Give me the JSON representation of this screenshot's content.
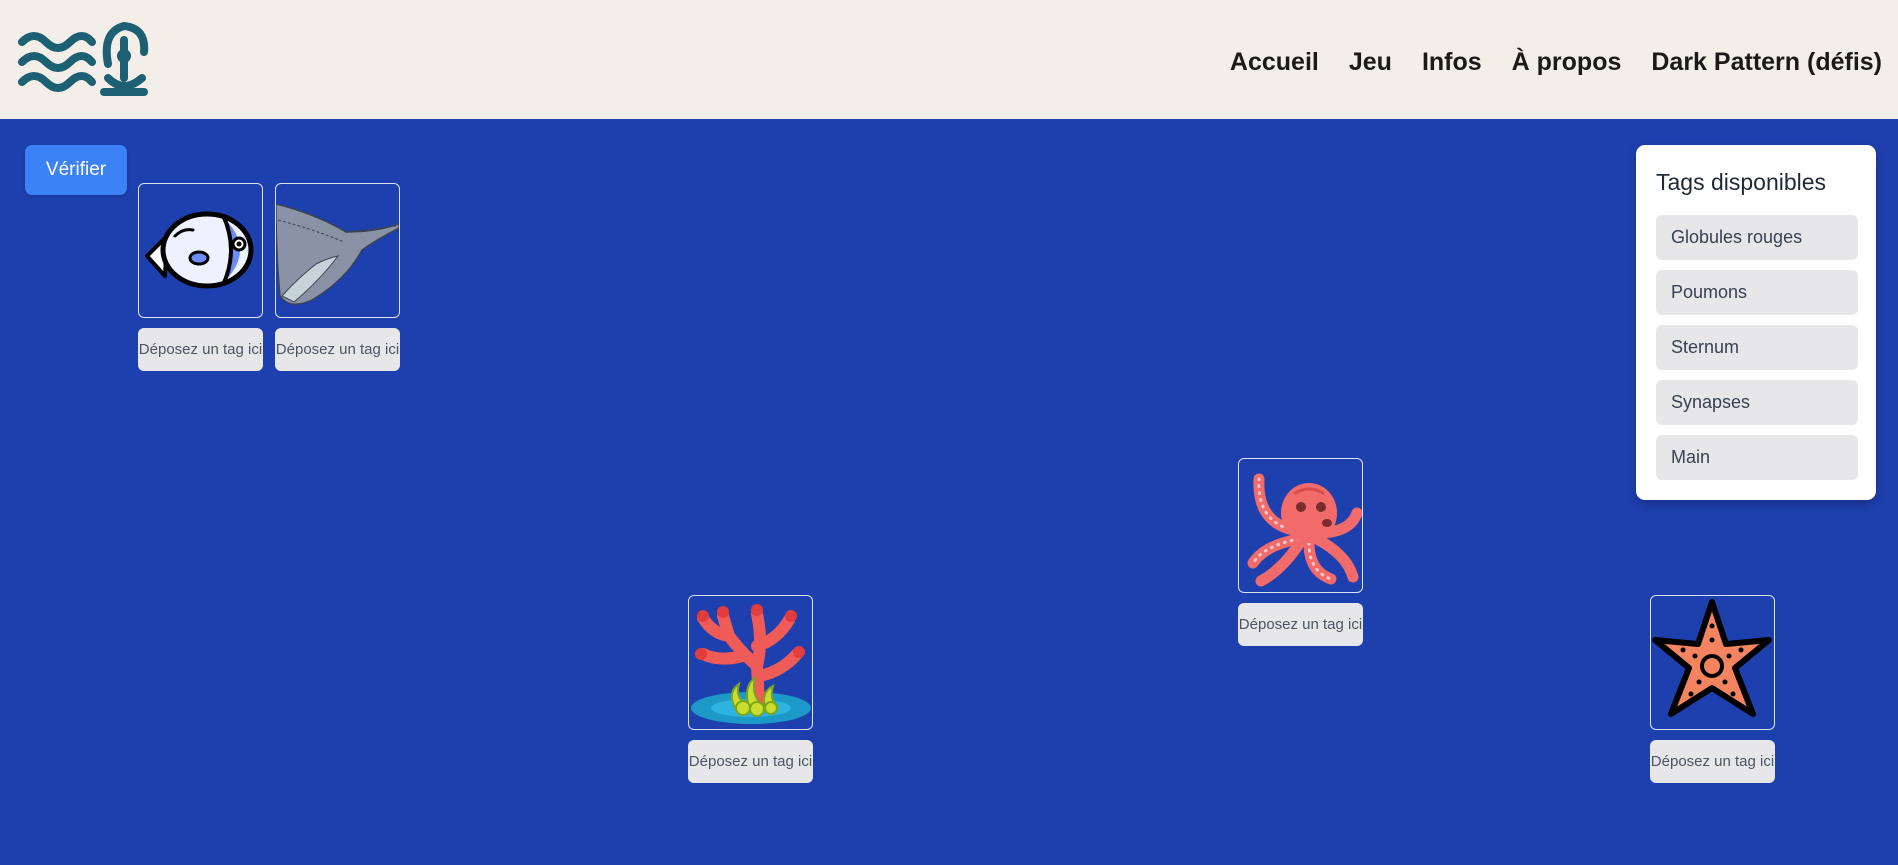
{
  "header": {
    "logo_icon": "waves-person-logo-icon",
    "nav": [
      "Accueil",
      "Jeu",
      "Infos",
      "À propos",
      "Dark Pattern (défis)"
    ]
  },
  "game": {
    "verify_label": "Vérifier",
    "cards": [
      {
        "icon": "fish-icon",
        "drop_label": "Déposez un tag ici"
      },
      {
        "icon": "stingray-icon",
        "drop_label": "Déposez un tag ici"
      },
      {
        "icon": "octopus-icon",
        "drop_label": "Déposez un tag ici"
      },
      {
        "icon": "coral-icon",
        "drop_label": "Déposez un tag ici"
      },
      {
        "icon": "starfish-icon",
        "drop_label": "Déposez un tag ici"
      }
    ]
  },
  "tags_panel": {
    "title": "Tags disponibles",
    "tags": [
      "Globules rouges",
      "Poumons",
      "Sternum",
      "Synapses",
      "Main"
    ]
  },
  "colors": {
    "background": "#1e40af",
    "header": "#f3eee8",
    "button": "#3b82f6",
    "logo": "#1d5f73"
  }
}
